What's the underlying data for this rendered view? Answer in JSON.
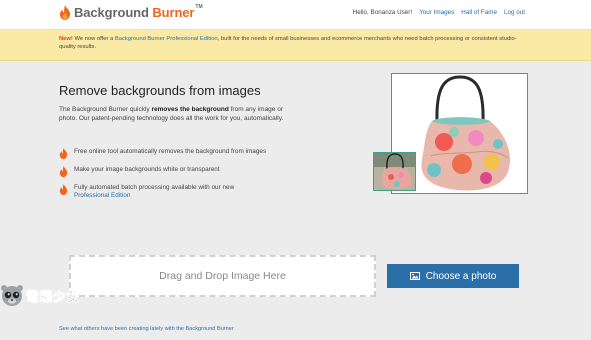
{
  "header": {
    "logo_part1": "Background ",
    "logo_part2": "Burner",
    "logo_tm": "TM",
    "greeting": "Hello, Bonanza User!",
    "nav": [
      "Your Images",
      "Hall of Fame",
      "Log out"
    ]
  },
  "banner": {
    "new_label": "New!",
    "text_before": " We now offer a ",
    "link_text": "Background Burner Professional Edition",
    "text_after": ", built for the needs of small businesses and ecommerce merchants who need batch processing or consistent studio-quality results."
  },
  "main": {
    "title": "Remove backgrounds from images",
    "intro_before": "The Background Burner quickly ",
    "intro_bold": "removes the background",
    "intro_after": " from any image or photo. Our patent-pending technology does all the work for you, automatically.",
    "features": [
      "Free online tool automatically removes the background from images",
      "Make your image backgrounds white or transparent",
      "Fully automated batch processing available with our new"
    ],
    "feature_link": "Professional Edition"
  },
  "upload": {
    "drop_text": "Drag and Drop Image Here",
    "button_label": "Choose a photo"
  },
  "footer": {
    "link": "See what others have been creating lately with the Background Burner"
  },
  "watermark": {
    "text": "電獺少女"
  },
  "colors": {
    "accent": "#f0661f",
    "link": "#2a6fa8",
    "banner_bg": "#fbe9a6",
    "image_border": "#3aa38a"
  },
  "icons": [
    "flame-icon",
    "photo-icon",
    "otter-icon"
  ]
}
